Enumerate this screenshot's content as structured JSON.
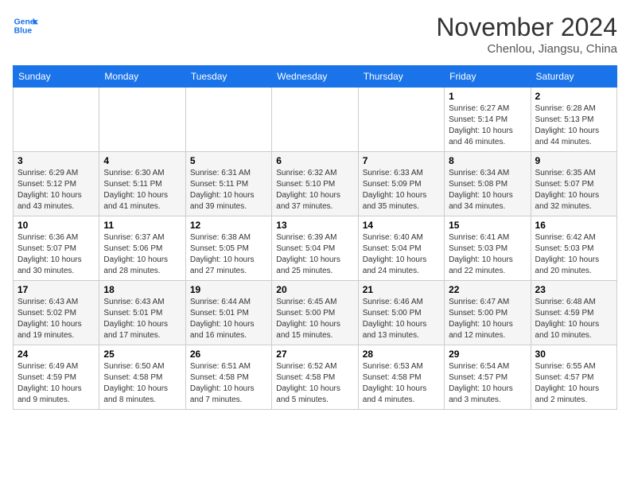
{
  "logo": {
    "line1": "General",
    "line2": "Blue"
  },
  "title": "November 2024",
  "location": "Chenlou, Jiangsu, China",
  "days_of_week": [
    "Sunday",
    "Monday",
    "Tuesday",
    "Wednesday",
    "Thursday",
    "Friday",
    "Saturday"
  ],
  "weeks": [
    [
      {
        "day": "",
        "info": ""
      },
      {
        "day": "",
        "info": ""
      },
      {
        "day": "",
        "info": ""
      },
      {
        "day": "",
        "info": ""
      },
      {
        "day": "",
        "info": ""
      },
      {
        "day": "1",
        "info": "Sunrise: 6:27 AM\nSunset: 5:14 PM\nDaylight: 10 hours and 46 minutes."
      },
      {
        "day": "2",
        "info": "Sunrise: 6:28 AM\nSunset: 5:13 PM\nDaylight: 10 hours and 44 minutes."
      }
    ],
    [
      {
        "day": "3",
        "info": "Sunrise: 6:29 AM\nSunset: 5:12 PM\nDaylight: 10 hours and 43 minutes."
      },
      {
        "day": "4",
        "info": "Sunrise: 6:30 AM\nSunset: 5:11 PM\nDaylight: 10 hours and 41 minutes."
      },
      {
        "day": "5",
        "info": "Sunrise: 6:31 AM\nSunset: 5:11 PM\nDaylight: 10 hours and 39 minutes."
      },
      {
        "day": "6",
        "info": "Sunrise: 6:32 AM\nSunset: 5:10 PM\nDaylight: 10 hours and 37 minutes."
      },
      {
        "day": "7",
        "info": "Sunrise: 6:33 AM\nSunset: 5:09 PM\nDaylight: 10 hours and 35 minutes."
      },
      {
        "day": "8",
        "info": "Sunrise: 6:34 AM\nSunset: 5:08 PM\nDaylight: 10 hours and 34 minutes."
      },
      {
        "day": "9",
        "info": "Sunrise: 6:35 AM\nSunset: 5:07 PM\nDaylight: 10 hours and 32 minutes."
      }
    ],
    [
      {
        "day": "10",
        "info": "Sunrise: 6:36 AM\nSunset: 5:07 PM\nDaylight: 10 hours and 30 minutes."
      },
      {
        "day": "11",
        "info": "Sunrise: 6:37 AM\nSunset: 5:06 PM\nDaylight: 10 hours and 28 minutes."
      },
      {
        "day": "12",
        "info": "Sunrise: 6:38 AM\nSunset: 5:05 PM\nDaylight: 10 hours and 27 minutes."
      },
      {
        "day": "13",
        "info": "Sunrise: 6:39 AM\nSunset: 5:04 PM\nDaylight: 10 hours and 25 minutes."
      },
      {
        "day": "14",
        "info": "Sunrise: 6:40 AM\nSunset: 5:04 PM\nDaylight: 10 hours and 24 minutes."
      },
      {
        "day": "15",
        "info": "Sunrise: 6:41 AM\nSunset: 5:03 PM\nDaylight: 10 hours and 22 minutes."
      },
      {
        "day": "16",
        "info": "Sunrise: 6:42 AM\nSunset: 5:03 PM\nDaylight: 10 hours and 20 minutes."
      }
    ],
    [
      {
        "day": "17",
        "info": "Sunrise: 6:43 AM\nSunset: 5:02 PM\nDaylight: 10 hours and 19 minutes."
      },
      {
        "day": "18",
        "info": "Sunrise: 6:43 AM\nSunset: 5:01 PM\nDaylight: 10 hours and 17 minutes."
      },
      {
        "day": "19",
        "info": "Sunrise: 6:44 AM\nSunset: 5:01 PM\nDaylight: 10 hours and 16 minutes."
      },
      {
        "day": "20",
        "info": "Sunrise: 6:45 AM\nSunset: 5:00 PM\nDaylight: 10 hours and 15 minutes."
      },
      {
        "day": "21",
        "info": "Sunrise: 6:46 AM\nSunset: 5:00 PM\nDaylight: 10 hours and 13 minutes."
      },
      {
        "day": "22",
        "info": "Sunrise: 6:47 AM\nSunset: 5:00 PM\nDaylight: 10 hours and 12 minutes."
      },
      {
        "day": "23",
        "info": "Sunrise: 6:48 AM\nSunset: 4:59 PM\nDaylight: 10 hours and 10 minutes."
      }
    ],
    [
      {
        "day": "24",
        "info": "Sunrise: 6:49 AM\nSunset: 4:59 PM\nDaylight: 10 hours and 9 minutes."
      },
      {
        "day": "25",
        "info": "Sunrise: 6:50 AM\nSunset: 4:58 PM\nDaylight: 10 hours and 8 minutes."
      },
      {
        "day": "26",
        "info": "Sunrise: 6:51 AM\nSunset: 4:58 PM\nDaylight: 10 hours and 7 minutes."
      },
      {
        "day": "27",
        "info": "Sunrise: 6:52 AM\nSunset: 4:58 PM\nDaylight: 10 hours and 5 minutes."
      },
      {
        "day": "28",
        "info": "Sunrise: 6:53 AM\nSunset: 4:58 PM\nDaylight: 10 hours and 4 minutes."
      },
      {
        "day": "29",
        "info": "Sunrise: 6:54 AM\nSunset: 4:57 PM\nDaylight: 10 hours and 3 minutes."
      },
      {
        "day": "30",
        "info": "Sunrise: 6:55 AM\nSunset: 4:57 PM\nDaylight: 10 hours and 2 minutes."
      }
    ]
  ]
}
